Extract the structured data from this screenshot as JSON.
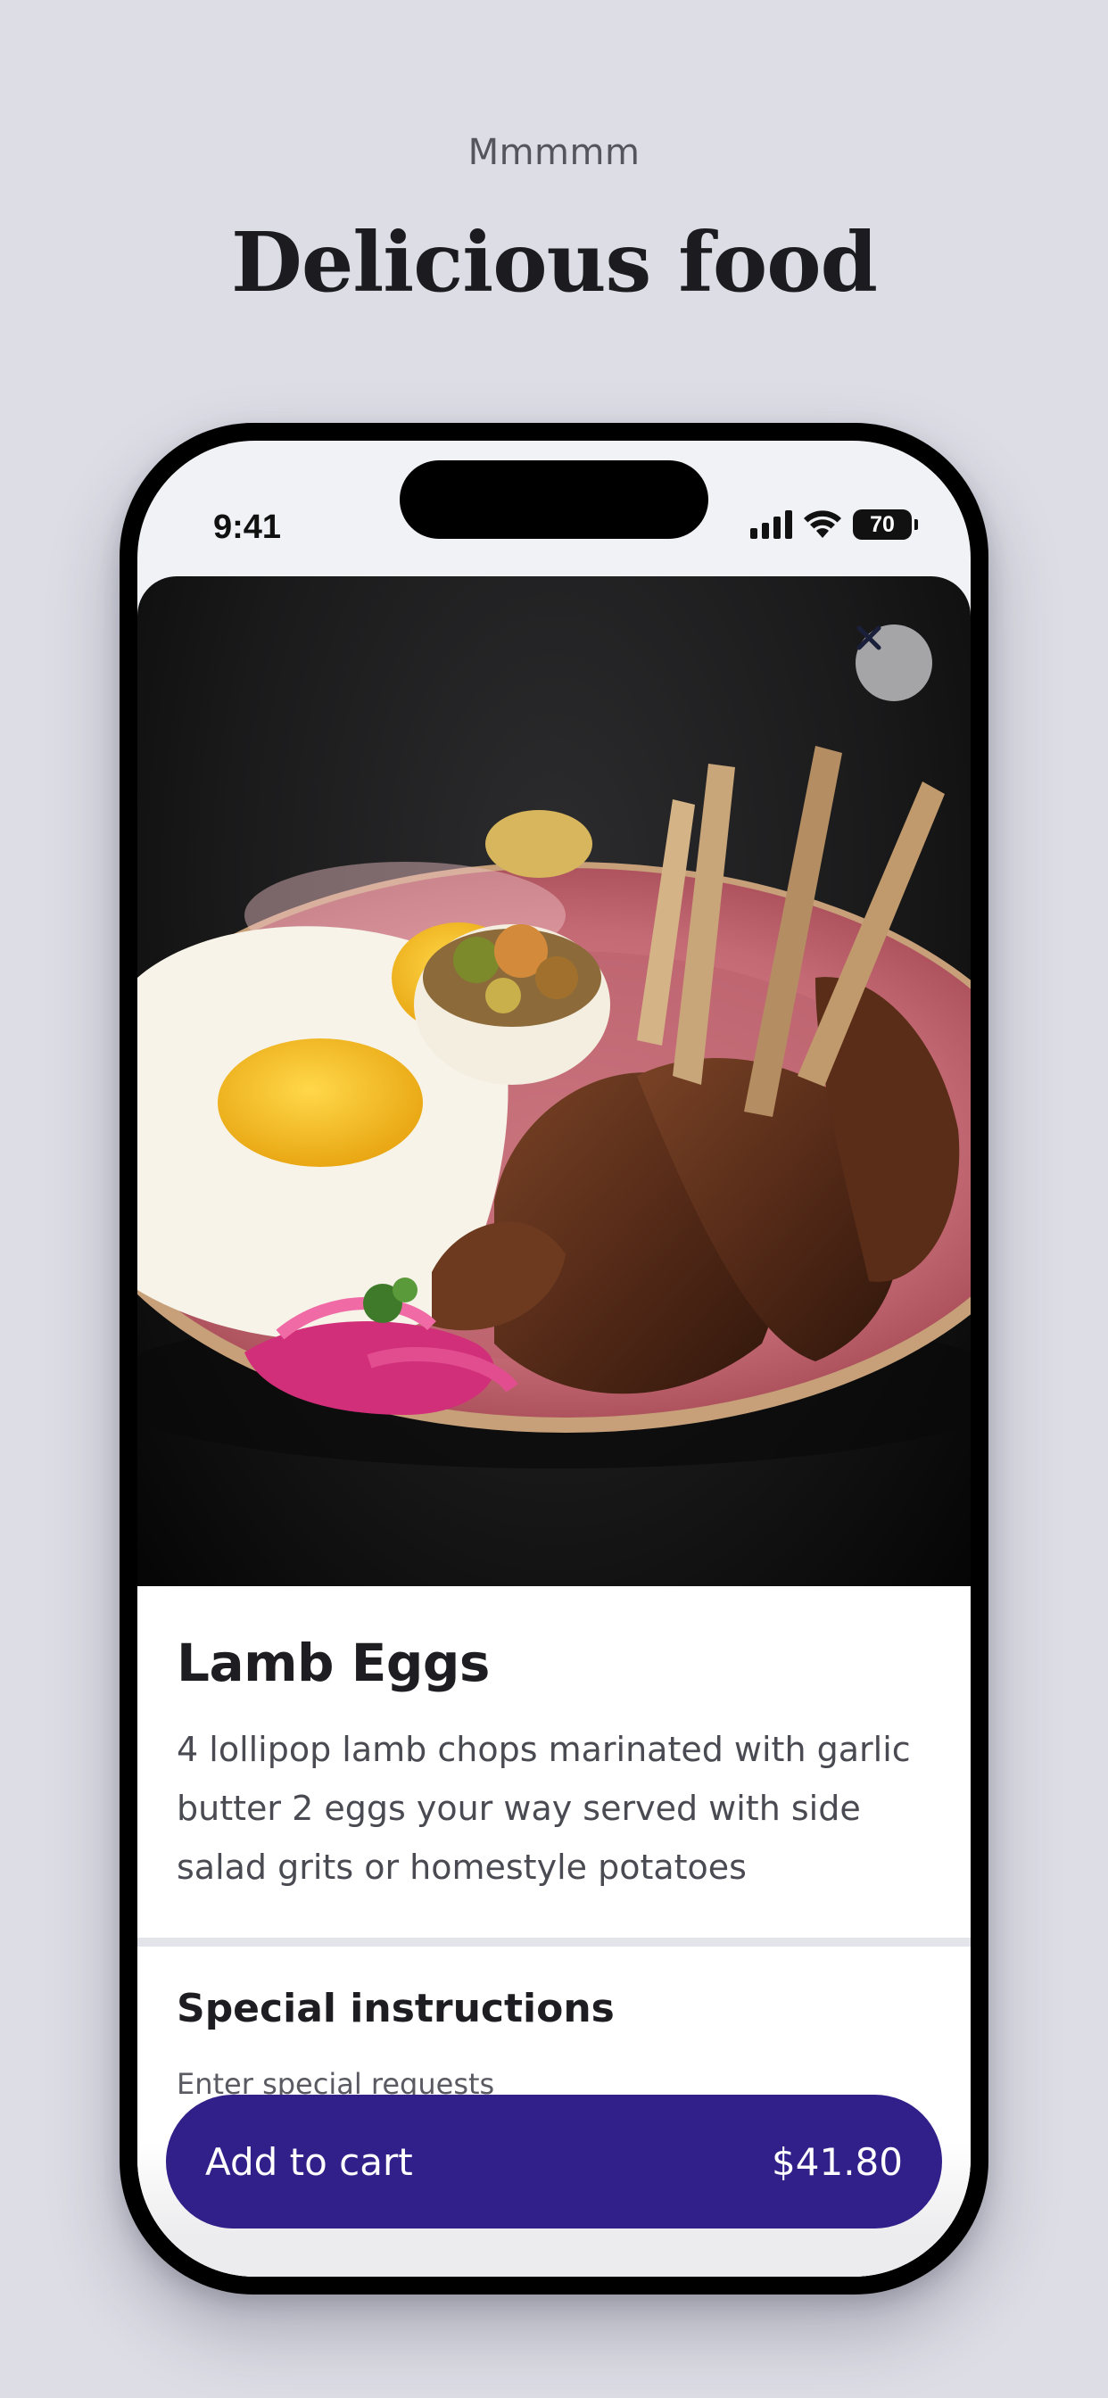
{
  "header": {
    "eyebrow": "Mmmmm",
    "title": "Delicious food"
  },
  "status_bar": {
    "time": "9:41",
    "battery": "70",
    "icons": [
      "cellular-signal-icon",
      "wifi-icon",
      "battery-icon"
    ]
  },
  "item": {
    "image_alt": "lamb-eggs-photo",
    "name": "Lamb Eggs",
    "description": "4 lollipop lamb chops marinated with garlic butter 2 eggs your way served with side salad grits or homestyle potatoes"
  },
  "instructions": {
    "title": "Special instructions",
    "placeholder": "Enter special requests"
  },
  "cart_button": {
    "label": "Add to cart",
    "price": "$41.80"
  },
  "colors": {
    "page_background": "#dcdde5",
    "accent": "#31208a",
    "text_primary": "#1e1e22"
  }
}
